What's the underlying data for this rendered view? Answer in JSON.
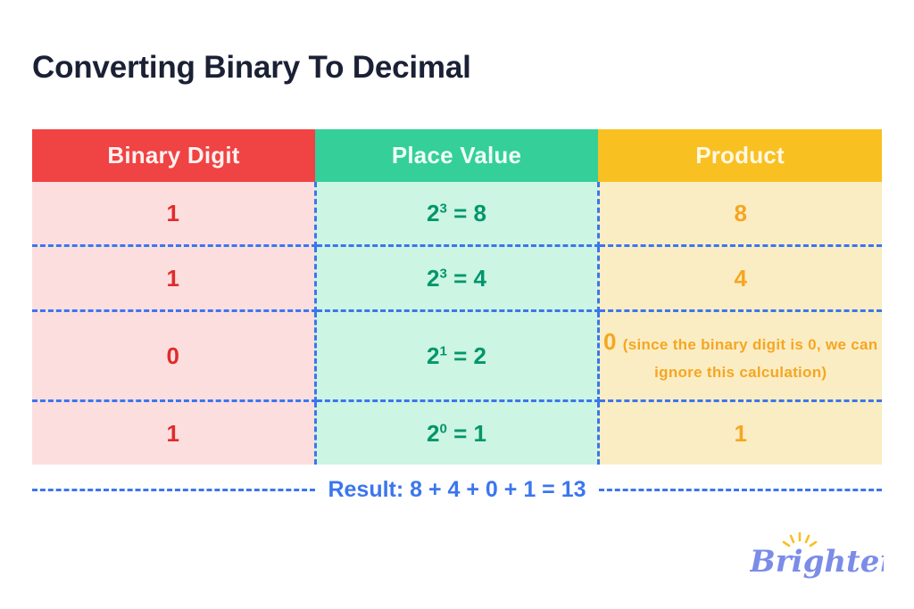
{
  "page": {
    "title": "Converting Binary To Decimal",
    "background": "#ffffff"
  },
  "colors": {
    "title": "#1B2135",
    "header_binary_bg": "#F04343",
    "header_place_bg": "#35CF9A",
    "header_product_bg": "#F9C022",
    "cell_binary_bg": "#FCDEDE",
    "cell_place_bg": "#CCF5E4",
    "cell_product_bg": "#FBEDC3",
    "binary_text": "#E12B2B",
    "place_text": "#02966A",
    "product_text": "#F5A623",
    "dashed_border": "#3B76EE",
    "result_text": "#3B76EE",
    "logo_text": "#7B8CE8",
    "logo_rays": "#F9C022"
  },
  "table": {
    "headers": [
      {
        "label": "Binary Digit"
      },
      {
        "label": "Place Value"
      },
      {
        "label": "Product"
      }
    ],
    "rows": [
      {
        "binary_digit": "1",
        "place_base": "2",
        "place_exponent": "3",
        "place_equals": "= 8",
        "product": "8",
        "product_note": ""
      },
      {
        "binary_digit": "1",
        "place_base": "2",
        "place_exponent": "3",
        "place_equals": "= 4",
        "product": "4",
        "product_note": ""
      },
      {
        "binary_digit": "0",
        "place_base": "2",
        "place_exponent": "1",
        "place_equals": "= 2",
        "product": "0",
        "product_note": "(since the binary digit is 0, we can ignore this calculation)"
      },
      {
        "binary_digit": "1",
        "place_base": "2",
        "place_exponent": "0",
        "place_equals": "= 1",
        "product": "1",
        "product_note": ""
      }
    ]
  },
  "result": {
    "text": "Result: 8 + 4 + 0 + 1 = 13"
  },
  "logo": {
    "name": "Brighterly"
  }
}
